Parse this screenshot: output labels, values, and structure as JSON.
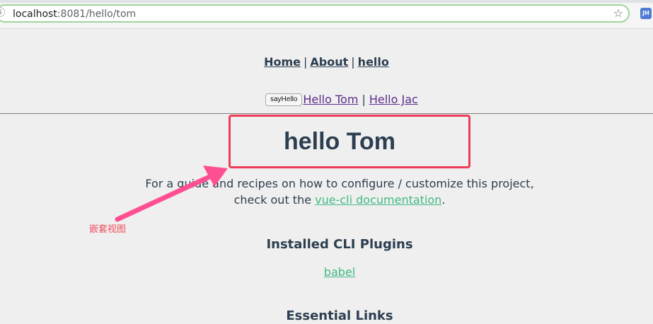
{
  "browser": {
    "url_host": "localhost",
    "url_rest": ":8081/hello/tom",
    "extension_label": "JH"
  },
  "icons": {
    "info": "info-icon",
    "star": "star-icon"
  },
  "nav": {
    "links": [
      "Home",
      "About",
      "hello"
    ],
    "separator": "|"
  },
  "hello_links": {
    "button_label": "sayHello",
    "links": [
      "Hello Tom",
      "Hello Jac"
    ],
    "separator": "|"
  },
  "content": {
    "title": "hello Tom",
    "guide_line1": "For a guide and recipes on how to configure / customize this project,",
    "guide_line2_prefix": "check out the ",
    "guide_link": "vue-cli documentation",
    "guide_line2_suffix": ".",
    "plugins_heading": "Installed CLI Plugins",
    "plugin": "babel",
    "essential_heading": "Essential Links"
  },
  "annotation": {
    "label": "嵌套视图",
    "color": "#ef4d5d"
  },
  "colors": {
    "link_green": "#42b983",
    "text_dark": "#2c3e50",
    "link_purple": "#5b2d8c",
    "highlight_red": "#ee3b59",
    "arrow_pink": "#ff4f93"
  }
}
